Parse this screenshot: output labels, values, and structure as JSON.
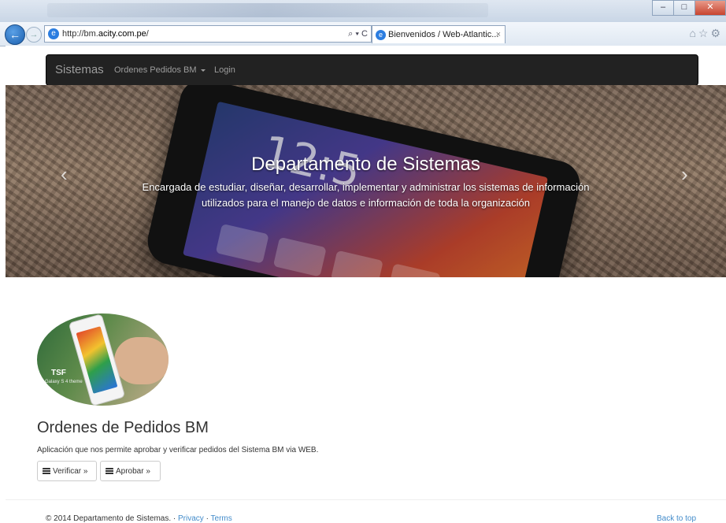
{
  "browser": {
    "url_prefix": "http://bm.",
    "url_domain": "acity.com.pe",
    "url_suffix": "/",
    "address_tools": "⌕ ▾ C",
    "tab_title": "Bienvenidos / Web-Atlantic...",
    "tab_close": "×",
    "back_symbol": "←",
    "forward_symbol": "→",
    "minimize": "–",
    "maximize": "□",
    "close": "✕",
    "right_icons": "⌂☆⚙"
  },
  "navbar": {
    "brand": "Sistemas",
    "pedidos_label": "Ordenes Pedidos BM",
    "login_label": "Login"
  },
  "carousel": {
    "title": "Departamento de Sistemas",
    "text": "Encargada de estudiar, diseñar, desarrollar, implementar y administrar los sistemas de información utilizados para el manejo de datos e información de toda la organización",
    "prev": "‹",
    "next": "›",
    "phone_clock": "12:5"
  },
  "feature": {
    "thumb_brand": "TSF",
    "thumb_sub": "Galaxy S 4 theme",
    "title": "Ordenes de Pedidos BM",
    "description": "Aplicación que nos permite aprobar y verificar pedidos del Sistema BM via WEB.",
    "verify_label": "Verificar »",
    "approve_label": "Aprobar »"
  },
  "footer": {
    "copyright": "© 2014 Departamento de Sistemas. · ",
    "privacy": "Privacy",
    "separator": " · ",
    "terms": "Terms",
    "back_to_top": "Back to top"
  }
}
